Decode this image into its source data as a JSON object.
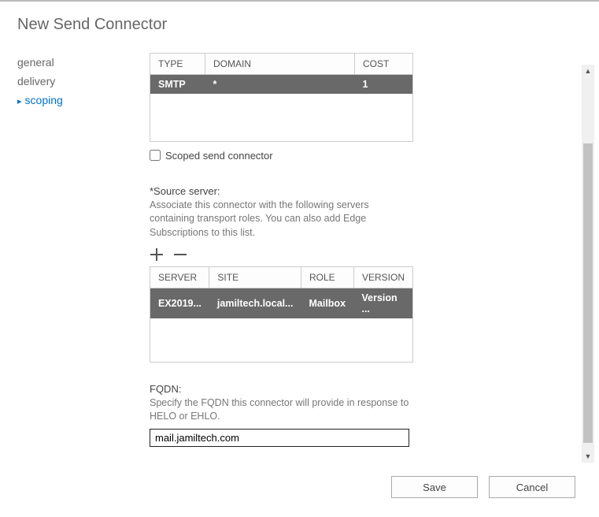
{
  "page_title": "New Send Connector",
  "sidebar": {
    "items": [
      {
        "label": "general",
        "active": false
      },
      {
        "label": "delivery",
        "active": false
      },
      {
        "label": "scoping",
        "active": true
      }
    ]
  },
  "address_space_table": {
    "headers": {
      "type": "TYPE",
      "domain": "DOMAIN",
      "cost": "COST"
    },
    "rows": [
      {
        "type": "SMTP",
        "domain": "*",
        "cost": "1"
      }
    ]
  },
  "scoped_checkbox": {
    "label": "Scoped send connector",
    "checked": false
  },
  "source_server": {
    "label": "*Source server:",
    "description": "Associate this connector with the following servers containing transport roles. You can also add Edge Subscriptions to this list."
  },
  "server_table": {
    "headers": {
      "server": "SERVER",
      "site": "SITE",
      "role": "ROLE",
      "version": "VERSION"
    },
    "rows": [
      {
        "server": "EX2019...",
        "site": "jamiltech.local...",
        "role": "Mailbox",
        "version": "Version ..."
      }
    ]
  },
  "fqdn": {
    "label": "FQDN:",
    "description": "Specify the FQDN this connector will provide in response to HELO or EHLO.",
    "value": "mail.jamiltech.com"
  },
  "footer": {
    "save": "Save",
    "cancel": "Cancel"
  }
}
